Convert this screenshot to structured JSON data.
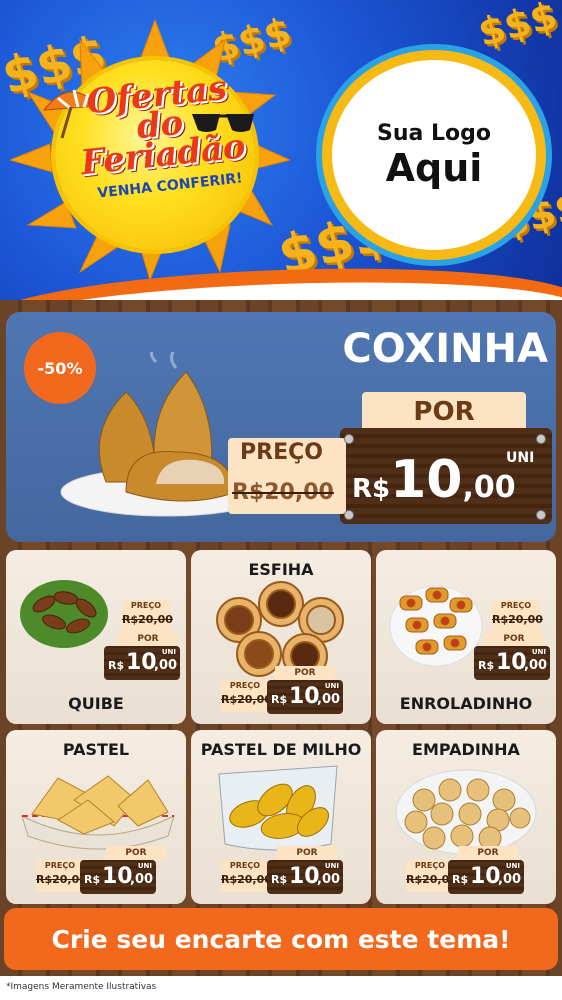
{
  "header": {
    "title_lines": [
      "Ofertas",
      "do",
      "Feriadão"
    ],
    "subtitle": "VENHA CONFERIR!",
    "logo_line1": "Sua Logo",
    "logo_line2": "Aqui",
    "dollar_symbol": "$$$"
  },
  "main_offer": {
    "discount": "-50%",
    "name": "COXINHA",
    "por_label": "POR",
    "preco_label": "PREÇO",
    "old_price": "R$20,00",
    "currency": "R$",
    "new_price_int": "10",
    "new_price_cents": ",00",
    "unit": "UNI"
  },
  "products": [
    {
      "name": "QUIBE",
      "preco_label": "PREÇO",
      "old_price": "R$20,00",
      "por_label": "POR",
      "currency": "R$",
      "price_int": "10",
      "price_cents": ",00",
      "unit": "UNI"
    },
    {
      "name": "ESFIHA",
      "preco_label": "PREÇO",
      "old_price": "R$20,00",
      "por_label": "POR",
      "currency": "R$",
      "price_int": "10",
      "price_cents": ",00",
      "unit": "UNI"
    },
    {
      "name": "ENROLADINHO",
      "preco_label": "PREÇO",
      "old_price": "R$20,00",
      "por_label": "POR",
      "currency": "R$",
      "price_int": "10",
      "price_cents": ",00",
      "unit": "UNI"
    },
    {
      "name": "PASTEL",
      "preco_label": "PREÇO",
      "old_price": "R$20,00",
      "por_label": "POR",
      "currency": "R$",
      "price_int": "10",
      "price_cents": ",00",
      "unit": "UNI"
    },
    {
      "name": "PASTEL DE MILHO",
      "preco_label": "PREÇO",
      "old_price": "R$20,00",
      "por_label": "POR",
      "currency": "R$",
      "price_int": "10",
      "price_cents": ",00",
      "unit": "UNI"
    },
    {
      "name": "EMPADINHA",
      "preco_label": "PREÇO",
      "old_price": "R$20,00",
      "por_label": "POR",
      "currency": "R$",
      "price_int": "10",
      "price_cents": ",00",
      "unit": "UNI"
    }
  ],
  "cta": "Crie seu encarte com este tema!",
  "disclaimer": "*Imagens Meramente Ilustrativas",
  "colors": {
    "header_blue": "#1c56d6",
    "sun_yellow": "#ffe020",
    "accent_orange": "#f2681c",
    "title_red": "#e9391a",
    "card_blue": "#4f77b3",
    "price_brown": "#4a2b14",
    "cream": "#fbe3c3"
  }
}
